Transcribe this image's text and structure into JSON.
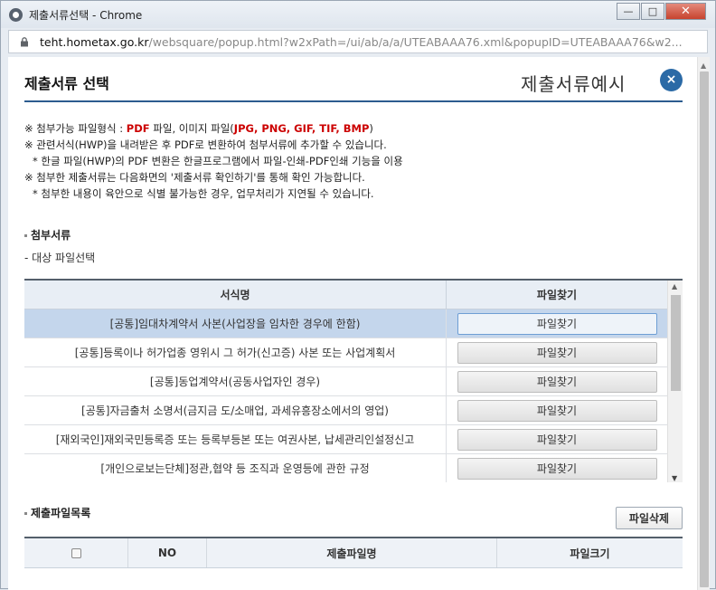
{
  "window": {
    "title": "제출서류선택 - Chrome",
    "minimize": "—",
    "maximize": "□",
    "close": "✕"
  },
  "address": {
    "host": "teht.hometax.go.kr",
    "path": "/websquare/popup.html?w2xPath=/ui/ab/a/a/UTEABAAA76.xml&popupID=UTEABAAA76&w2..."
  },
  "header": {
    "title": "제출서류 선택",
    "example": "제출서류예시",
    "close_symbol": "×"
  },
  "notes": {
    "line1_pre": "※ 첨부가능 파일형식 : ",
    "line1_pdf": "PDF",
    "line1_mid": " 파일, 이미지 파일(",
    "line1_img": "JPG, PNG, GIF, TIF, BMP",
    "line1_post": ")",
    "line2": "※ 관련서식(HWP)을 내려받은 후 PDF로 변환하여 첨부서류에 추가할 수 있습니다.",
    "line3": "* 한글 파일(HWP)의 PDF 변환은 한글프로그램에서 파일-인쇄-PDF인쇄 기능을 이용",
    "line4": "※ 첨부한 제출서류는 다음화면의 '제출서류 확인하기'를 통해 확인 가능합니다.",
    "line5": "* 첨부한 내용이 육안으로 식별 불가능한 경우, 업무처리가 지연될 수 있습니다."
  },
  "attach": {
    "section_title": "첨부서류",
    "subtitle": "- 대상 파일선택",
    "col_name": "서식명",
    "col_action": "파일찾기",
    "rows": [
      {
        "name": "[공통]임대차계약서 사본(사업장을 임차한 경우에 한함)",
        "button": "파일찾기"
      },
      {
        "name": "[공통]등록이나 허가업종 영위시 그 허가(신고증) 사본 또는 사업계획서",
        "button": "파일찾기"
      },
      {
        "name": "[공통]동업계약서(공동사업자인 경우)",
        "button": "파일찾기"
      },
      {
        "name": "[공통]자금출처 소명서(금지금 도/소매업, 과세유흥장소에서의 영업)",
        "button": "파일찾기"
      },
      {
        "name": "[재외국인]재외국민등록증 또는 등록부등본 또는 여권사본, 납세관리인설정신고",
        "button": "파일찾기"
      },
      {
        "name": "[개인으로보는단체]정관,협약 등 조직과 운영등에 관한 규정",
        "button": "파일찾기"
      }
    ]
  },
  "submitted": {
    "section_title": "제출파일목록",
    "delete_button": "파일삭제",
    "col_no": "NO",
    "col_filename": "제출파일명",
    "col_size": "파일크기"
  }
}
